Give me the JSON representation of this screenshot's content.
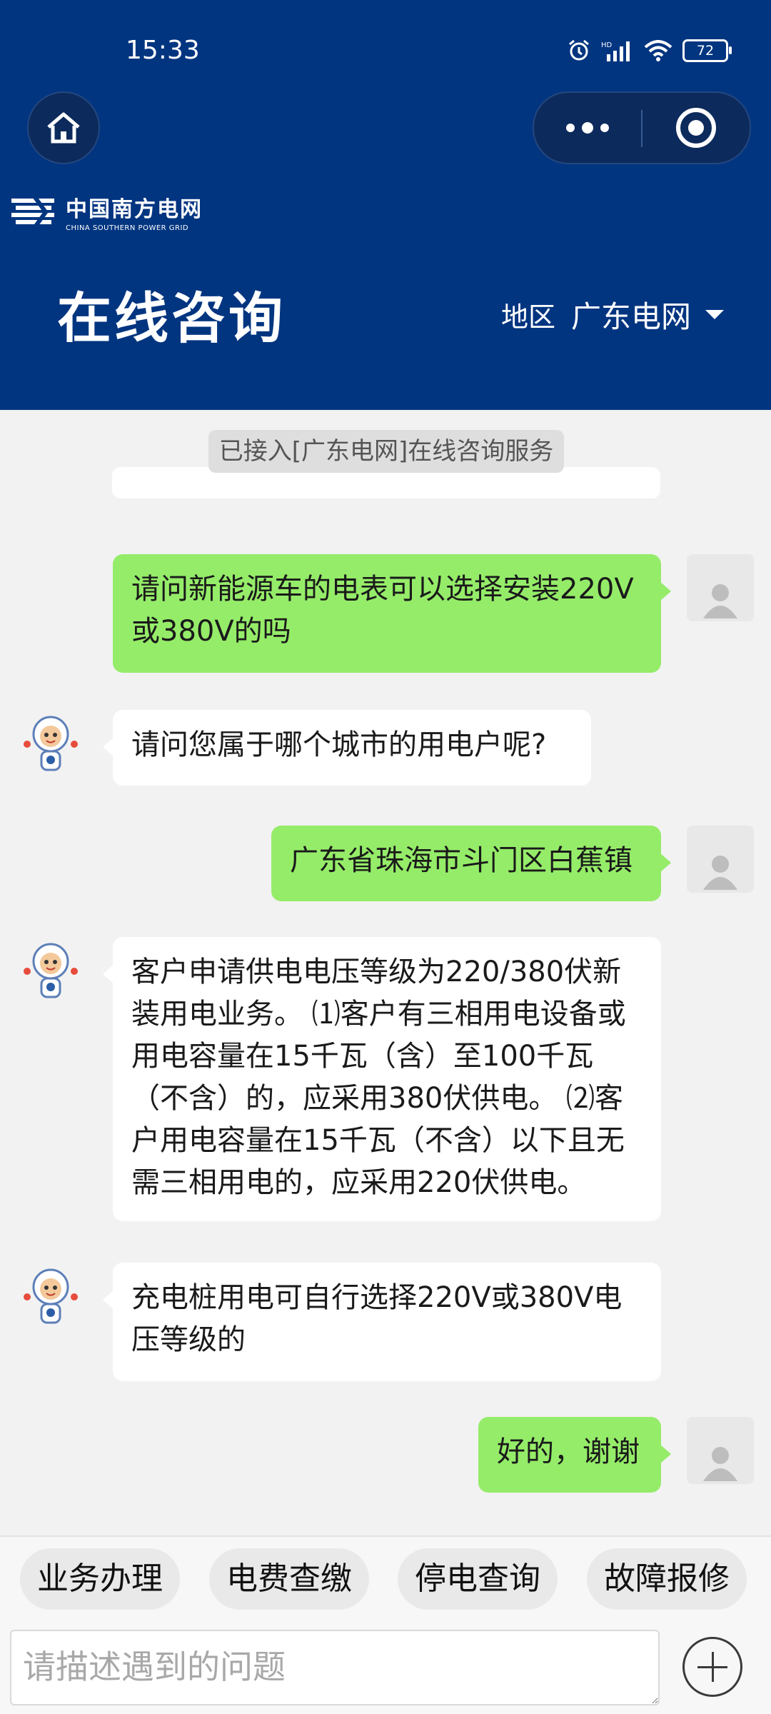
{
  "status_bar": {
    "time": "15:33",
    "battery": "72"
  },
  "header": {
    "logo_cn": "中国南方电网",
    "logo_en": "CHINA SOUTHERN POWER GRID",
    "title": "在线咨询",
    "region_label": "地区",
    "region_value": "广东电网"
  },
  "chat": {
    "system_notice": "已接入[广东电网]在线咨询服务",
    "messages": [
      {
        "from": "user",
        "text": "请问新能源车的电表可以选择安装220V或380V的吗"
      },
      {
        "from": "bot",
        "text": "请问您属于哪个城市的用电户呢?"
      },
      {
        "from": "user",
        "text": "广东省珠海市斗门区白蕉镇"
      },
      {
        "from": "bot",
        "text": "客户申请供电电压等级为220/380伏新装用电业务。 ⑴客户有三相用电设备或用电容量在15千瓦（含）至100千瓦（不含）的，应采用380伏供电。 ⑵客户用电容量在15千瓦（不含）以下且无需三相用电的，应采用220伏供电。"
      },
      {
        "from": "bot",
        "text": "充电桩用电可自行选择220V或380V电压等级的"
      },
      {
        "from": "user",
        "text": "好的，谢谢"
      }
    ]
  },
  "quick_replies": [
    "业务办理",
    "电费查缴",
    "停电查询",
    "故障报修"
  ],
  "input": {
    "placeholder": "请描述遇到的问题"
  },
  "colors": {
    "header_bg": "#023580",
    "user_bubble": "#95ec69",
    "bot_bubble": "#ffffff",
    "chat_bg": "#f2f2f2"
  }
}
